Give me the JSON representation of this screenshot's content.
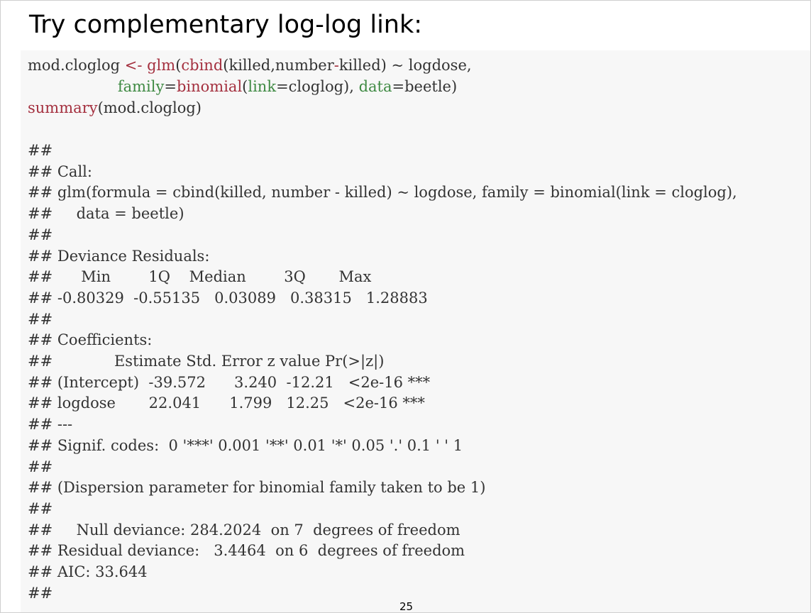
{
  "slide": {
    "title": "Try complementary log-log link:",
    "page_number": "25"
  },
  "code": {
    "line1": [
      {
        "t": "mod.cloglog ",
        "c": "plain"
      },
      {
        "t": "<-",
        "c": "kw"
      },
      {
        "t": " ",
        "c": "plain"
      },
      {
        "t": "glm",
        "c": "kw"
      },
      {
        "t": "(",
        "c": "plain"
      },
      {
        "t": "cbind",
        "c": "kw"
      },
      {
        "t": "(killed,number",
        "c": "plain"
      },
      {
        "t": "-",
        "c": "kw"
      },
      {
        "t": "killed) ~ logdose,",
        "c": "plain"
      }
    ],
    "line2": [
      {
        "t": "                   ",
        "c": "plain"
      },
      {
        "t": "family",
        "c": "arg"
      },
      {
        "t": "=",
        "c": "plain"
      },
      {
        "t": "binomial",
        "c": "kw"
      },
      {
        "t": "(",
        "c": "plain"
      },
      {
        "t": "link",
        "c": "arg"
      },
      {
        "t": "=cloglog), ",
        "c": "plain"
      },
      {
        "t": "data",
        "c": "arg"
      },
      {
        "t": "=beetle)",
        "c": "plain"
      }
    ],
    "line3": [
      {
        "t": "summary",
        "c": "kw"
      },
      {
        "t": "(mod.cloglog)",
        "c": "plain"
      }
    ]
  },
  "output": {
    "lines": [
      "##",
      "## Call:",
      "## glm(formula = cbind(killed, number - killed) ~ logdose, family = binomial(link = cloglog),",
      "##     data = beetle)",
      "##",
      "## Deviance Residuals:",
      "##      Min        1Q    Median        3Q       Max",
      "## -0.80329  -0.55135   0.03089   0.38315   1.28883",
      "##",
      "## Coefficients:",
      "##             Estimate Std. Error z value Pr(>|z|)",
      "## (Intercept)  -39.572      3.240  -12.21   <2e-16 ***",
      "## logdose       22.041      1.799   12.25   <2e-16 ***",
      "## ---",
      "## Signif. codes:  0 '***' 0.001 '**' 0.01 '*' 0.05 '.' 0.1 ' ' 1",
      "##",
      "## (Dispersion parameter for binomial family taken to be 1)",
      "##",
      "##     Null deviance: 284.2024  on 7  degrees of freedom",
      "## Residual deviance:   3.4464  on 6  degrees of freedom",
      "## AIC: 33.644",
      "##"
    ]
  }
}
